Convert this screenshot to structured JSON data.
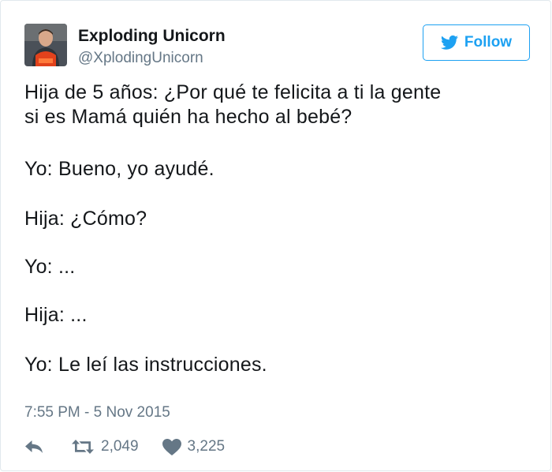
{
  "user": {
    "display_name": "Exploding Unicorn",
    "handle": "@XplodingUnicorn"
  },
  "follow_label": "Follow",
  "tweet": {
    "lines": [
      "Hija de 5 años: ¿Por qué te felicita a ti la gente",
      "si es Mamá quién ha hecho al bebé?",
      "Yo: Bueno, yo ayudé.",
      "Hija: ¿Cómo?",
      "Yo: ...",
      "Hija: ...",
      "Yo: Le leí las instrucciones."
    ]
  },
  "timestamp": "7:55 PM - 5 Nov 2015",
  "stats": {
    "retweets": "2,049",
    "likes": "3,225"
  },
  "icons": {
    "avatar": "avatar-photo",
    "follow": "twitter-bird-icon",
    "reply": "reply-icon",
    "retweet": "retweet-icon",
    "like": "heart-icon"
  },
  "colors": {
    "accent": "#1da1f2",
    "text": "#14171a",
    "secondary": "#657786"
  }
}
